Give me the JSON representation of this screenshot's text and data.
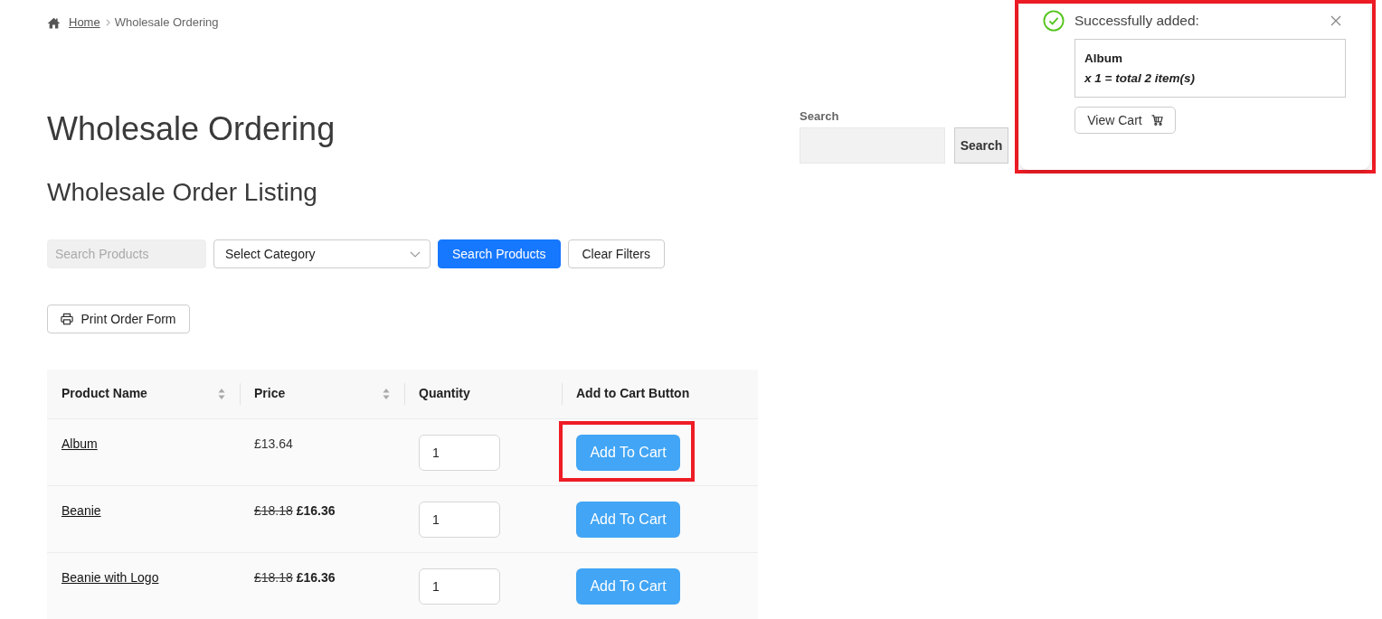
{
  "breadcrumb": [
    {
      "label": "Home",
      "link": true
    },
    {
      "label": "Wholesale Ordering",
      "link": false
    }
  ],
  "page_title": "Wholesale Ordering",
  "section_title": "Wholesale Order Listing",
  "filters": {
    "search": {
      "placeholder": "Search Products"
    },
    "category": {
      "value": "Select Category"
    },
    "buttons": [
      {
        "label": "Search Products",
        "kind": "primary"
      },
      {
        "label": "Clear Filters",
        "kind": "outline"
      }
    ]
  },
  "print_button": {
    "label": "Print Order Form"
  },
  "table": {
    "columns": [
      {
        "label": "Product Name",
        "sortable": true
      },
      {
        "label": "Price",
        "sortable": true
      },
      {
        "label": "Quantity",
        "sortable": false
      },
      {
        "label": "Add to Cart Button",
        "sortable": false
      }
    ],
    "rows": [
      {
        "name": "Album",
        "price": "£13.64",
        "quantity": "1",
        "button": "Add To Cart",
        "highlighted": true
      },
      {
        "name": "Beanie",
        "old_price": "£18.18",
        "sale_price": "£16.36",
        "quantity": "1",
        "button": "Add To Cart",
        "highlighted": false
      },
      {
        "name": "Beanie with Logo",
        "old_price": "£18.18",
        "sale_price": "£16.36",
        "quantity": "1",
        "button": "Add To Cart",
        "highlighted": false
      }
    ]
  },
  "sidebar_search": {
    "label": "Search",
    "button": "Search"
  },
  "notification": {
    "title": "Successfully added:",
    "product": "Album",
    "detail": "x 1 = total 2 item(s)",
    "button": "View Cart",
    "highlighted": true
  }
}
